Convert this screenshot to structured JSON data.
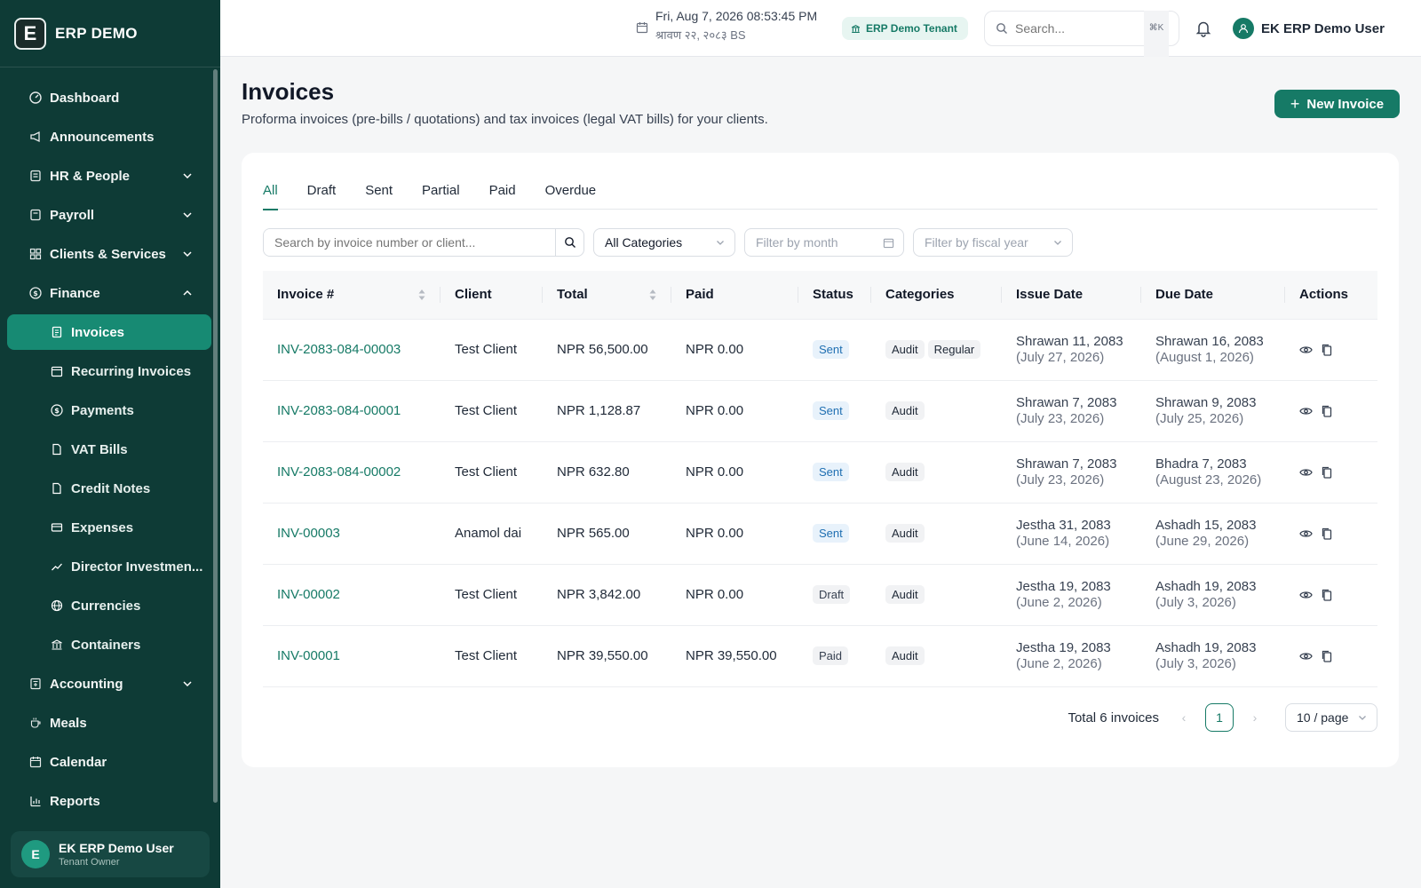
{
  "brand": {
    "name": "ERP DEMO",
    "logo_letter": "E"
  },
  "sidebar": {
    "items": [
      {
        "label": "Dashboard",
        "icon": "dashboard-icon"
      },
      {
        "label": "Announcements",
        "icon": "megaphone-icon"
      },
      {
        "label": "HR & People",
        "icon": "people-icon",
        "expandable": true
      },
      {
        "label": "Payroll",
        "icon": "payroll-icon",
        "expandable": true
      },
      {
        "label": "Clients & Services",
        "icon": "grid-icon",
        "expandable": true
      },
      {
        "label": "Finance",
        "icon": "dollar-circle-icon",
        "expanded": true
      }
    ],
    "finance_sub": [
      {
        "label": "Invoices",
        "icon": "invoice-icon",
        "active": true
      },
      {
        "label": "Recurring Invoices",
        "icon": "calendar-icon"
      },
      {
        "label": "Payments",
        "icon": "dollar-circle-icon"
      },
      {
        "label": "VAT Bills",
        "icon": "document-icon"
      },
      {
        "label": "Credit Notes",
        "icon": "document-icon"
      },
      {
        "label": "Expenses",
        "icon": "card-icon"
      },
      {
        "label": "Director Investmen...",
        "icon": "trending-up-icon"
      },
      {
        "label": "Currencies",
        "icon": "globe-icon"
      },
      {
        "label": "Containers",
        "icon": "bank-icon"
      }
    ],
    "items_after": [
      {
        "label": "Accounting",
        "icon": "calculator-icon",
        "expandable": true
      },
      {
        "label": "Meals",
        "icon": "cup-icon"
      },
      {
        "label": "Calendar",
        "icon": "calendar-icon"
      },
      {
        "label": "Reports",
        "icon": "bar-chart-icon"
      }
    ],
    "user": {
      "initial": "E",
      "name": "EK ERP Demo User",
      "role": "Tenant Owner"
    }
  },
  "topbar": {
    "datetime": "Fri, Aug 7, 2026 08:53:45 PM",
    "datetime_bs": "श्रावण २२, २०८३ BS",
    "tenant": "ERP Demo Tenant",
    "search_placeholder": "Search...",
    "shortcut": "⌘K",
    "user_name": "EK ERP Demo User"
  },
  "page": {
    "title": "Invoices",
    "subtitle": "Proforma invoices (pre-bills / quotations) and tax invoices (legal VAT bills) for your clients.",
    "new_button": "New Invoice"
  },
  "tabs": [
    "All",
    "Draft",
    "Sent",
    "Partial",
    "Paid",
    "Overdue"
  ],
  "active_tab": "All",
  "filters": {
    "search_placeholder": "Search by invoice number or client...",
    "category": "All Categories",
    "month_placeholder": "Filter by month",
    "fiscal_placeholder": "Filter by fiscal year"
  },
  "table": {
    "columns": [
      "Invoice #",
      "Client",
      "Total",
      "Paid",
      "Status",
      "Categories",
      "Issue Date",
      "Due Date",
      "Actions"
    ],
    "rows": [
      {
        "invoice": "INV-2083-084-00003",
        "client": "Test Client",
        "total": "NPR 56,500.00",
        "paid": "NPR 0.00",
        "status": "Sent",
        "categories": [
          "Audit",
          "Regular"
        ],
        "issue": "Shrawan 11, 2083",
        "issue_ad": "(July 27, 2026)",
        "due": "Shrawan 16, 2083",
        "due_ad": "(August 1, 2026)"
      },
      {
        "invoice": "INV-2083-084-00001",
        "client": "Test Client",
        "total": "NPR 1,128.87",
        "paid": "NPR 0.00",
        "status": "Sent",
        "categories": [
          "Audit"
        ],
        "issue": "Shrawan 7, 2083",
        "issue_ad": "(July 23, 2026)",
        "due": "Shrawan 9, 2083",
        "due_ad": "(July 25, 2026)"
      },
      {
        "invoice": "INV-2083-084-00002",
        "client": "Test Client",
        "total": "NPR 632.80",
        "paid": "NPR 0.00",
        "status": "Sent",
        "categories": [
          "Audit"
        ],
        "issue": "Shrawan 7, 2083",
        "issue_ad": "(July 23, 2026)",
        "due": "Bhadra 7, 2083",
        "due_ad": "(August 23, 2026)"
      },
      {
        "invoice": "INV-00003",
        "client": "Anamol dai",
        "total": "NPR 565.00",
        "paid": "NPR 0.00",
        "status": "Sent",
        "categories": [
          "Audit"
        ],
        "issue": "Jestha 31, 2083",
        "issue_ad": "(June 14, 2026)",
        "due": "Ashadh 15, 2083",
        "due_ad": "(June 29, 2026)"
      },
      {
        "invoice": "INV-00002",
        "client": "Test Client",
        "total": "NPR 3,842.00",
        "paid": "NPR 0.00",
        "status": "Draft",
        "categories": [
          "Audit"
        ],
        "issue": "Jestha 19, 2083",
        "issue_ad": "(June 2, 2026)",
        "due": "Ashadh 19, 2083",
        "due_ad": "(July 3, 2026)"
      },
      {
        "invoice": "INV-00001",
        "client": "Test Client",
        "total": "NPR 39,550.00",
        "paid": "NPR 39,550.00",
        "status": "Paid",
        "categories": [
          "Audit"
        ],
        "issue": "Jestha 19, 2083",
        "issue_ad": "(June 2, 2026)",
        "due": "Ashadh 19, 2083",
        "due_ad": "(July 3, 2026)"
      }
    ]
  },
  "pagination": {
    "total_text": "Total 6 invoices",
    "current_page": "1",
    "page_size": "10 / page"
  },
  "colors": {
    "sidebar_bg": "#0e3b36",
    "accent": "#167a66",
    "active_nav": "#178a73"
  }
}
